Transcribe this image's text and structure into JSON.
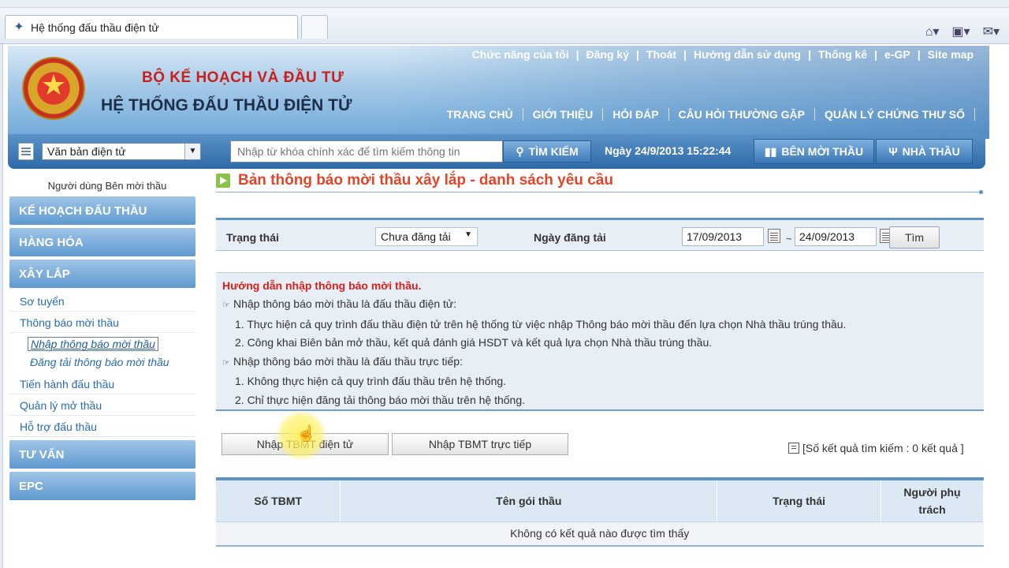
{
  "browser": {
    "tab_title": "Hệ thống đấu thầu điện tử"
  },
  "header": {
    "ministry": "BỘ KẾ HOẠCH VÀ ĐẦU TƯ",
    "system_name": "HỆ THỐNG ĐẤU THẦU ĐIỆN TỬ",
    "top_links": [
      "Chức năng của tôi",
      "Đăng ký",
      "Thoát",
      "Hướng dẫn sử dụng",
      "Thống kê",
      "e-GP",
      "Site map"
    ],
    "nav": [
      "TRANG CHỦ",
      "GIỚI THIỆU",
      "HỎI ĐÁP",
      "CÂU HỎI THƯỜNG GẶP",
      "QUẢN LÝ CHỨNG THƯ SỐ"
    ]
  },
  "search": {
    "type_value": "Văn bản điện tử",
    "placeholder": "Nhập từ khóa chính xác để tìm kiếm thông tin",
    "button": "TÌM KIẾM",
    "datetime": "Ngày 24/9/2013 15:22:44",
    "role_inviter": "BÊN MỜI THẦU",
    "role_contractor": "NHÀ THẦU"
  },
  "sidebar": {
    "user_label": "Người dùng Bên mời thầu",
    "cat_plan": "KẾ HOẠCH ĐẤU THẦU",
    "cat_goods": "HÀNG HÓA",
    "cat_construction": "XÂY LẮP",
    "sub_prequal": "Sơ tuyển",
    "sub_notice": "Thông báo mời thầu",
    "subsub_enter": "Nhập thông báo mời thầu",
    "subsub_publish": "Đăng tải thông báo mời thầu",
    "sub_conduct": "Tiến hành đấu thầu",
    "sub_opening": "Quản lý mở thầu",
    "sub_support": "Hỗ trợ đấu thầu",
    "cat_consulting": "TƯ VẤN",
    "cat_epc": "EPC"
  },
  "main": {
    "title": "Bản thông báo mời thầu xây lắp - danh sách yêu cầu",
    "filter": {
      "status_label": "Trạng thái",
      "status_value": "Chưa đăng tải",
      "date_label": "Ngày đăng tải",
      "date_from": "17/09/2013",
      "tilde": "~",
      "date_to": "24/09/2013",
      "find_button": "Tìm"
    },
    "guide": {
      "title": "Hướng dẫn nhập thông báo mời thầu.",
      "heading1": "Nhập thông báo mời thầu là đấu thầu điện tử:",
      "item1_1": "1. Thực hiện cả quy trình đấu thầu điện tử trên hệ thống từ việc nhập Thông báo mời thầu đến lựa chọn Nhà thầu trúng thầu.",
      "item1_2": "2. Công khai Biên bản mở thầu, kết quả đánh giá HSDT và kết quả lựa chọn Nhà thầu trúng thầu.",
      "heading2": "Nhập thông báo mời thầu là đấu thầu trực tiếp:",
      "item2_1": "1. Không thực hiện cả quy trình đấu thầu trên hệ thống.",
      "item2_2": "2. Chỉ thực hiện đăng tải thông báo mời thầu trên hệ thống."
    },
    "buttons": {
      "electronic": "Nhập TBMT điện tử",
      "direct": "Nhập TBMT trực tiếp"
    },
    "result_count": "[Số kết quả tìm kiếm : 0 kết quả ]",
    "table": {
      "col_id": "Số TBMT",
      "col_name": "Tên gói thầu",
      "col_status": "Trạng thái",
      "col_owner_1": "Người phụ",
      "col_owner_2": "trách",
      "empty": "Không có kết quả nào được tìm thấy"
    }
  },
  "colors": {
    "header_blue": "#5c93c9",
    "title_orange": "#e0462a",
    "ministry_red": "#c8201a"
  }
}
